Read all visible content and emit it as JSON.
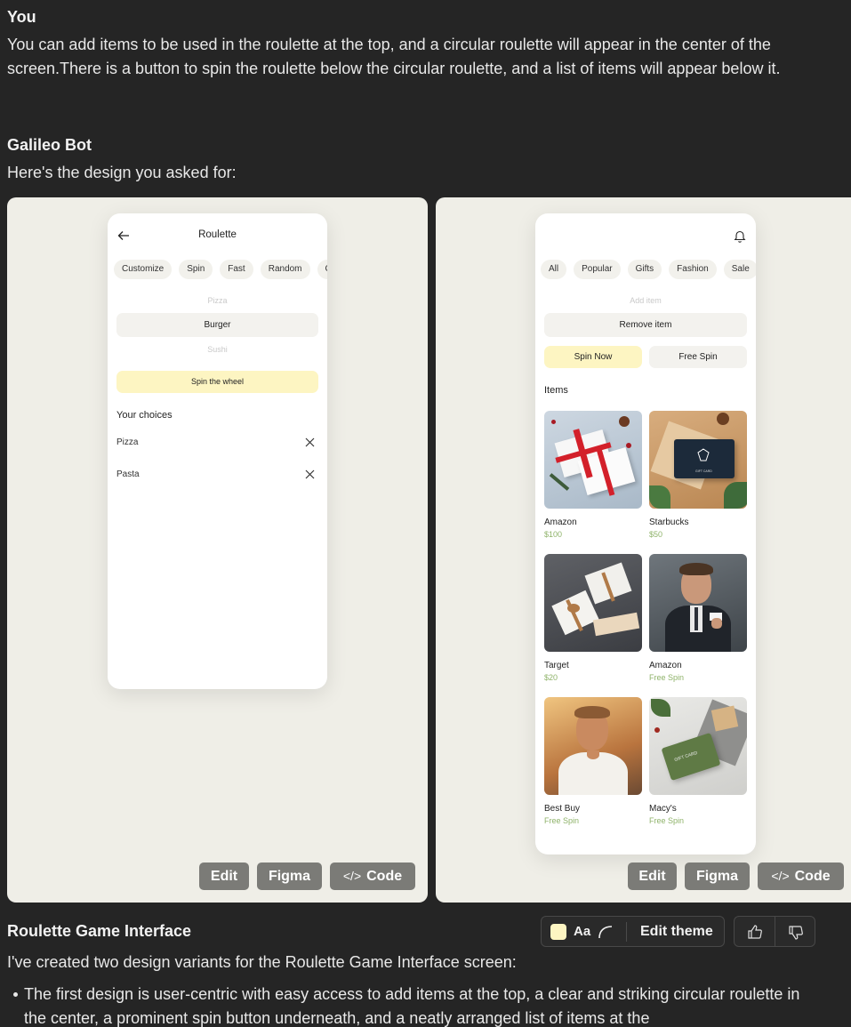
{
  "chat": {
    "user_name": "You",
    "user_message": "You can add items to be used in the roulette at the top, and a circular roulette will appear in the center of the screen.There is a button to spin the roulette below the circular roulette, and a list of items will appear below it.",
    "bot_name": "Galileo Bot",
    "bot_intro": "Here's the design you asked for:",
    "design_title": "Roulette Game Interface",
    "summary": "I've created two design variants for the Roulette Game Interface screen:",
    "bullets": [
      "The first design is user-centric with easy access to add items at the top, a clear and striking circular roulette in the center, a prominent spin button underneath, and a neatly arranged list of items at the"
    ]
  },
  "design1": {
    "title": "Roulette",
    "chips": [
      "Customize",
      "Spin",
      "Fast",
      "Random",
      "C"
    ],
    "picker": {
      "above": "Pizza",
      "selected": "Burger",
      "below": "Sushi"
    },
    "spin_label": "Spin the wheel",
    "choices_heading": "Your choices",
    "choices": [
      "Pizza",
      "Pasta"
    ]
  },
  "design2": {
    "chips": [
      "All",
      "Popular",
      "Gifts",
      "Fashion",
      "Sale"
    ],
    "add_placeholder": "Add item",
    "remove_label": "Remove item",
    "spin_now_label": "Spin Now",
    "free_spin_label": "Free Spin",
    "items_heading": "Items",
    "items": [
      {
        "name": "Amazon",
        "price": "$100"
      },
      {
        "name": "Starbucks",
        "price": "$50"
      },
      {
        "name": "Target",
        "price": "$20"
      },
      {
        "name": "Amazon",
        "price": "Free Spin"
      },
      {
        "name": "Best Buy",
        "price": "Free Spin"
      },
      {
        "name": "Macy's",
        "price": "Free Spin"
      }
    ],
    "card_logo_text": "GIFT CARD",
    "card_logo_text2": "GIFT CARD"
  },
  "actions": {
    "edit": "Edit",
    "figma": "Figma",
    "code": "Code",
    "code_glyph": "</>"
  },
  "theme": {
    "font_sample": "Aa",
    "edit_theme": "Edit theme",
    "swatch_color": "#fdf5c2"
  },
  "colors": {
    "accent_yellow": "#fdf5c2",
    "price_green": "#8fb36a",
    "card_bg": "#efeee7",
    "page_bg": "#252525"
  }
}
